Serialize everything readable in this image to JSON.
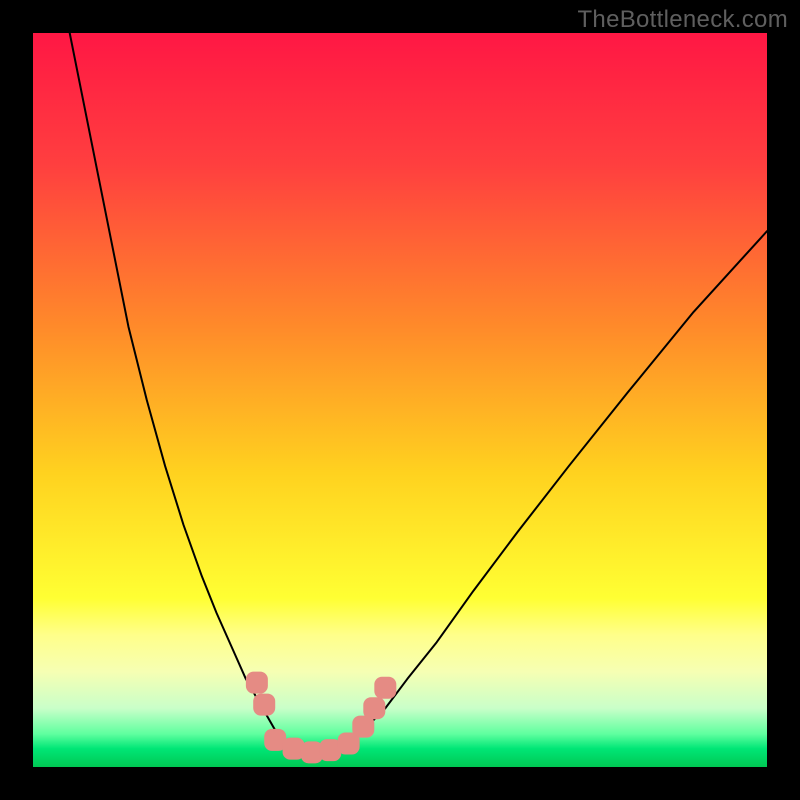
{
  "watermark": {
    "text": "TheBottleneck.com"
  },
  "chart_data": {
    "type": "line",
    "title": "",
    "xlabel": "",
    "ylabel": "",
    "xlim": [
      0,
      100
    ],
    "ylim": [
      0,
      100
    ],
    "grid": false,
    "legend": null,
    "background": {
      "style": "vertical-gradient",
      "stops": [
        {
          "pos": 0.0,
          "color": "#ff1744"
        },
        {
          "pos": 0.18,
          "color": "#ff3f3f"
        },
        {
          "pos": 0.4,
          "color": "#ff8a2a"
        },
        {
          "pos": 0.6,
          "color": "#ffd21f"
        },
        {
          "pos": 0.77,
          "color": "#ffff33"
        },
        {
          "pos": 0.82,
          "color": "#ffff8a"
        },
        {
          "pos": 0.87,
          "color": "#f6ffb3"
        },
        {
          "pos": 0.92,
          "color": "#c9ffc9"
        },
        {
          "pos": 0.955,
          "color": "#5fff9f"
        },
        {
          "pos": 0.975,
          "color": "#00e676"
        },
        {
          "pos": 1.0,
          "color": "#00c853"
        }
      ]
    },
    "series": [
      {
        "name": "bottleneck-curve-left",
        "color": "#000000",
        "width": 2,
        "x": [
          5,
          7,
          9,
          11,
          13,
          15.5,
          18,
          20.5,
          23,
          25,
          27,
          29,
          31,
          33,
          35
        ],
        "y": [
          100,
          90,
          80,
          70,
          60,
          50,
          41,
          33,
          26,
          21,
          16.5,
          12,
          8.5,
          5,
          3
        ]
      },
      {
        "name": "bottleneck-curve-right",
        "color": "#000000",
        "width": 2,
        "x": [
          43,
          45,
          48,
          51,
          55,
          60,
          66,
          73,
          81,
          90,
          100
        ],
        "y": [
          3,
          5,
          8,
          12,
          17,
          24,
          32,
          41,
          51,
          62,
          73
        ]
      },
      {
        "name": "valley-floor",
        "color": "#000000",
        "width": 2,
        "x": [
          35,
          37,
          39,
          41,
          43
        ],
        "y": [
          3,
          2.3,
          2.2,
          2.3,
          3
        ]
      }
    ],
    "markers": [
      {
        "name": "left-cluster",
        "shape": "rounded-square",
        "color": "#e58b84",
        "size": 22,
        "points": [
          {
            "x": 30.5,
            "y": 11.5
          },
          {
            "x": 31.5,
            "y": 8.5
          },
          {
            "x": 33.0,
            "y": 3.7
          },
          {
            "x": 35.5,
            "y": 2.5
          },
          {
            "x": 38.0,
            "y": 2.0
          },
          {
            "x": 40.5,
            "y": 2.3
          },
          {
            "x": 43.0,
            "y": 3.2
          }
        ]
      },
      {
        "name": "right-cluster",
        "shape": "rounded-square",
        "color": "#e58b84",
        "size": 22,
        "points": [
          {
            "x": 45.0,
            "y": 5.5
          },
          {
            "x": 46.5,
            "y": 8.0
          },
          {
            "x": 48.0,
            "y": 10.8
          }
        ]
      }
    ]
  }
}
